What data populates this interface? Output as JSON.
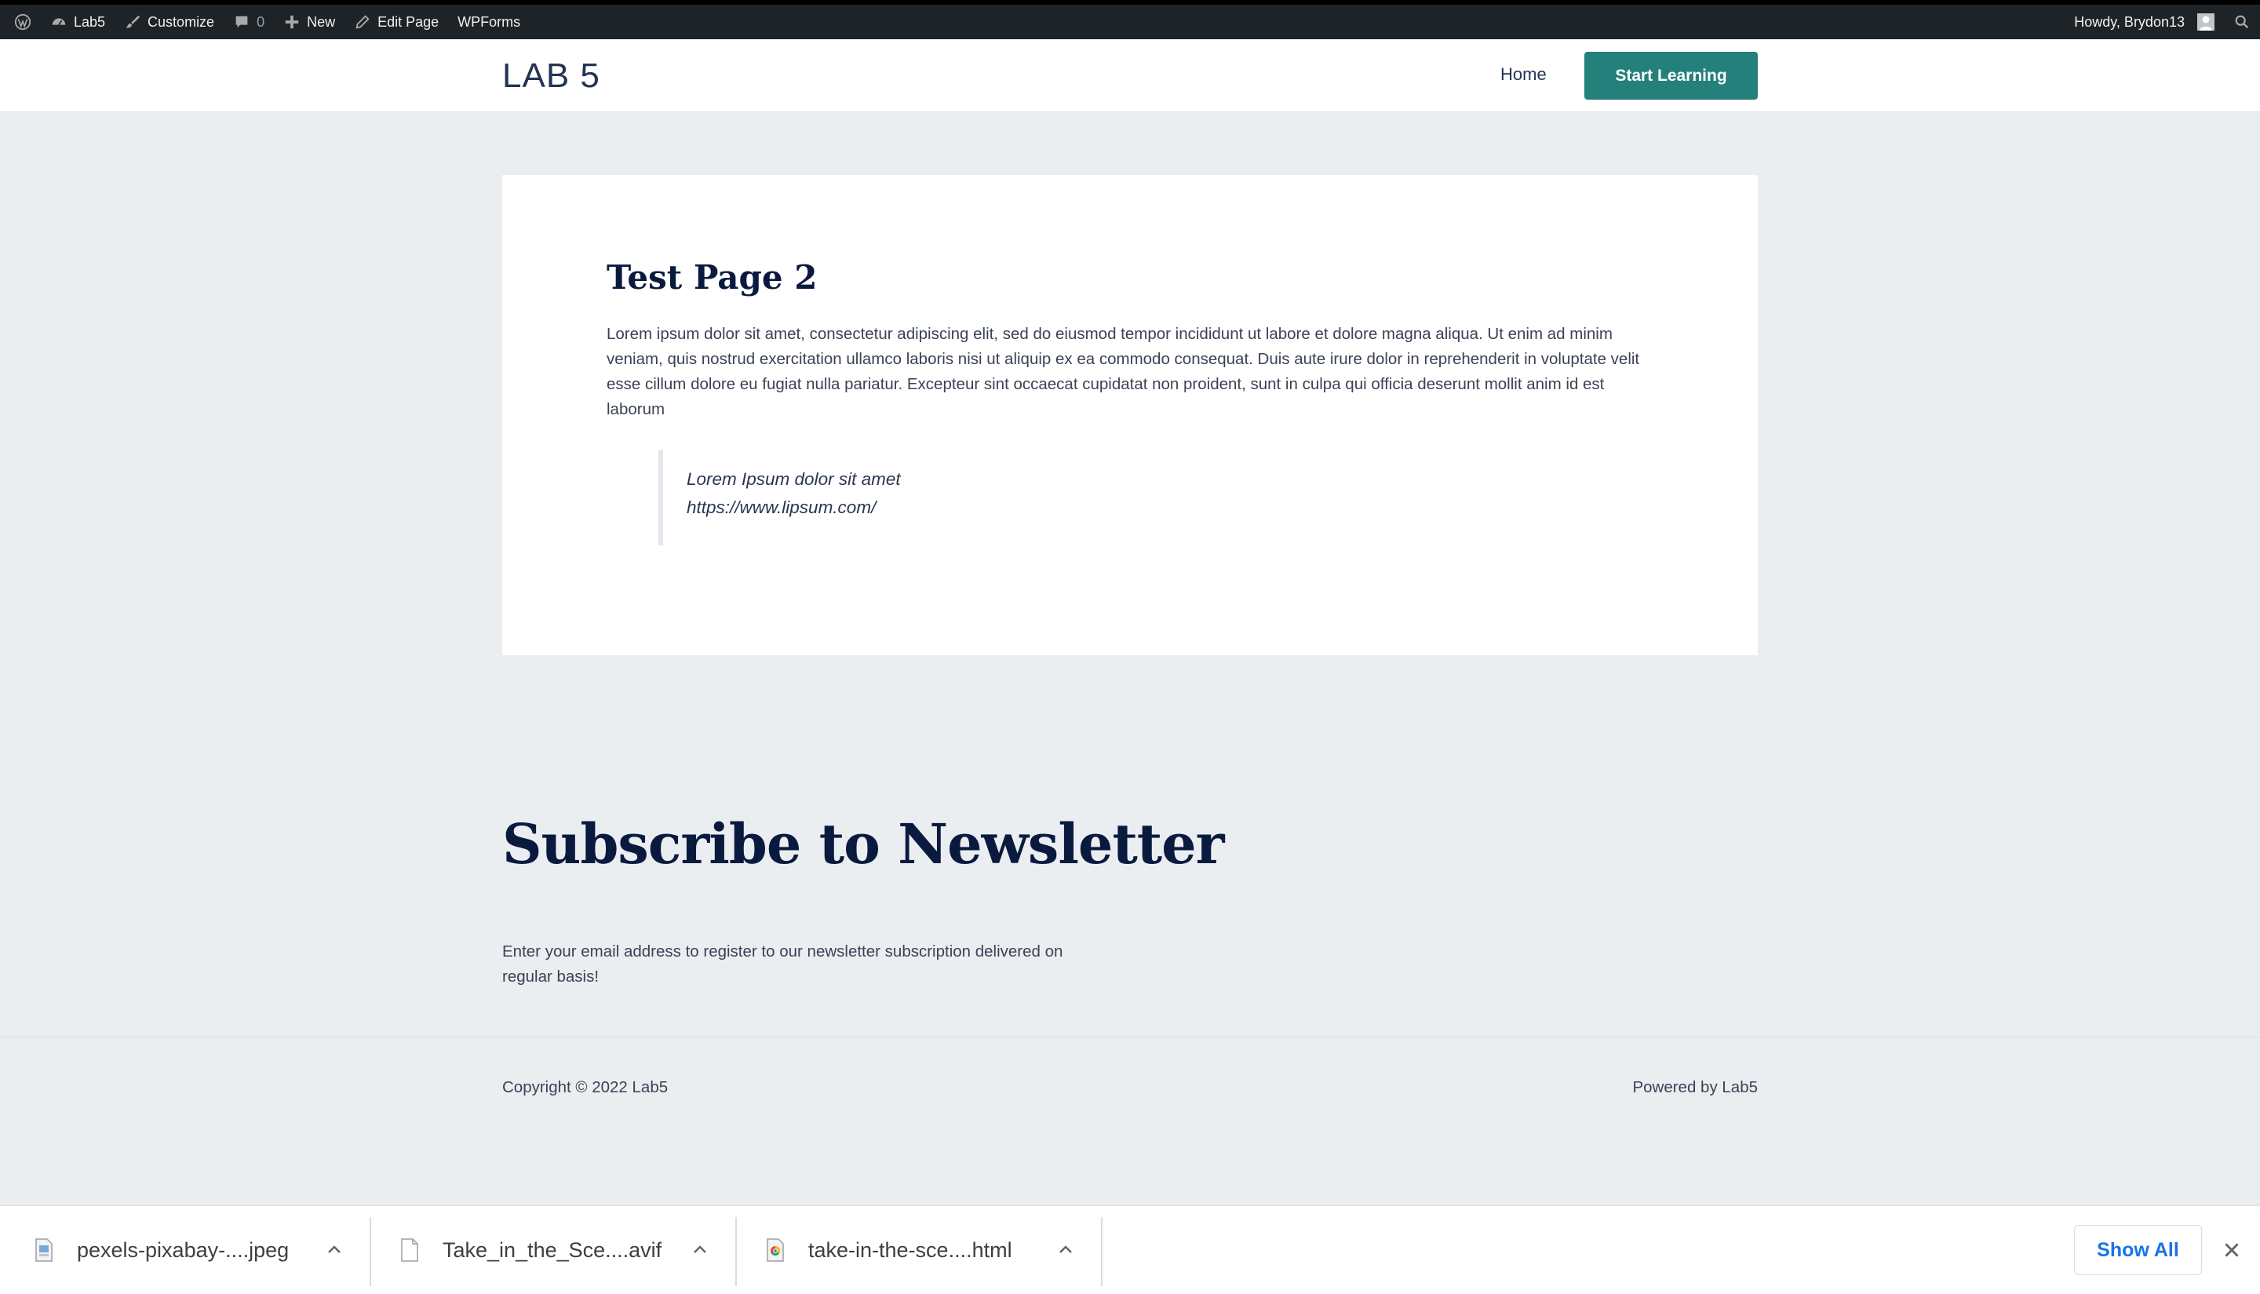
{
  "admin_bar": {
    "site_name": "Lab5",
    "customize": "Customize",
    "comments_count": "0",
    "new": "New",
    "edit_page": "Edit Page",
    "wpforms": "WPForms",
    "howdy": "Howdy, Brydon13"
  },
  "header": {
    "site_title": "LAB 5",
    "nav_home": "Home",
    "cta": "Start Learning",
    "cta_color": "#24807a"
  },
  "page": {
    "title": "Test Page 2",
    "body": "Lorem ipsum dolor sit amet, consectetur adipiscing elit, sed do eiusmod tempor incididunt ut labore et dolore magna aliqua. Ut enim ad minim veniam, quis nostrud exercitation ullamco laboris nisi ut aliquip ex ea commodo consequat. Duis aute irure dolor in reprehenderit in voluptate velit esse cillum dolore eu fugiat nulla pariatur. Excepteur sint occaecat cupidatat non proident, sunt in culpa qui officia deserunt mollit anim id est laborum",
    "quote_line1": "Lorem Ipsum dolor sit amet",
    "quote_line2": "https://www.lipsum.com/"
  },
  "newsletter": {
    "title": "Subscribe to Newsletter",
    "text": "Enter your email address to register to our newsletter subscription delivered on regular basis!"
  },
  "footer": {
    "copyright": "Copyright © 2022 Lab5",
    "powered": "Powered by Lab5"
  },
  "downloads": {
    "items": [
      {
        "name": "pexels-pixabay-....jpeg",
        "icon": "image-file-icon"
      },
      {
        "name": "Take_in_the_Sce....avif",
        "icon": "blank-file-icon"
      },
      {
        "name": "take-in-the-sce....html",
        "icon": "chrome-file-icon"
      }
    ],
    "show_all": "Show All"
  }
}
